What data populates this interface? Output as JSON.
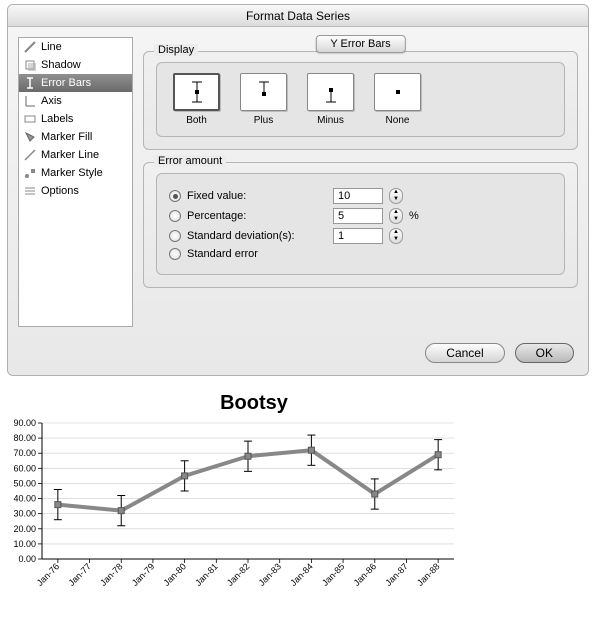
{
  "window": {
    "title": "Format Data Series"
  },
  "sidebar": {
    "items": [
      {
        "label": "Line"
      },
      {
        "label": "Shadow"
      },
      {
        "label": "Error Bars"
      },
      {
        "label": "Axis"
      },
      {
        "label": "Labels"
      },
      {
        "label": "Marker Fill"
      },
      {
        "label": "Marker Line"
      },
      {
        "label": "Marker Style"
      },
      {
        "label": "Options"
      }
    ]
  },
  "tab": {
    "label": "Y Error Bars"
  },
  "display": {
    "group_label": "Display",
    "options": [
      {
        "label": "Both"
      },
      {
        "label": "Plus"
      },
      {
        "label": "Minus"
      },
      {
        "label": "None"
      }
    ]
  },
  "error_amount": {
    "group_label": "Error amount",
    "fixed_label": "Fixed value:",
    "fixed_value": "10",
    "percentage_label": "Percentage:",
    "percentage_value": "5",
    "percent_sign": "%",
    "stddev_label": "Standard deviation(s):",
    "stddev_value": "1",
    "stderr_label": "Standard error"
  },
  "buttons": {
    "cancel": "Cancel",
    "ok": "OK"
  },
  "chart_data": {
    "type": "line",
    "title": "Bootsy",
    "categories": [
      "Jan-76",
      "Jan-77",
      "Jan-78",
      "Jan-79",
      "Jan-80",
      "Jan-81",
      "Jan-82",
      "Jan-83",
      "Jan-84",
      "Jan-85",
      "Jan-86",
      "Jan-87",
      "Jan-88"
    ],
    "values": [
      36,
      null,
      32,
      null,
      55,
      null,
      68,
      null,
      72,
      null,
      43,
      null,
      69
    ],
    "error": 10,
    "ylim": [
      0,
      90
    ],
    "ystep": 10,
    "xlabel": "",
    "ylabel": ""
  }
}
